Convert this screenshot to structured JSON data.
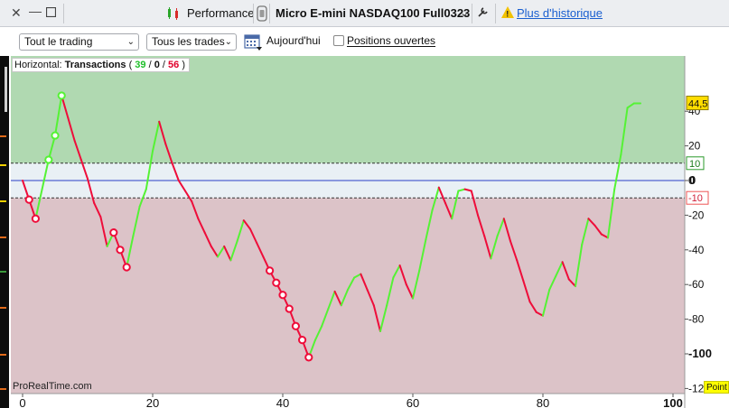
{
  "titlebar": {
    "title": "Performance",
    "instrument": "Micro E-mini NASDAQ100 Full0323",
    "history_link": "Plus d'historique"
  },
  "toolbar": {
    "trading_filter": "Tout le trading",
    "trades_filter": "Tous les trades",
    "today": "Aujourd'hui",
    "open_positions": "Positions ouvertes"
  },
  "chart": {
    "title_prefix": "Horizontal:",
    "title_main": "Transactions",
    "paren_open": "(",
    "wins": "39",
    "slash": "/",
    "neutral": "0",
    "losses": "56",
    "paren_close": ")",
    "watermark": "ProRealTime.com",
    "point_label": "Point",
    "colors": {
      "up": "#55f235",
      "down": "#ee0d3a",
      "profit_zone": "#b0d9b1",
      "loss_zone": "#dcc3c8",
      "neutral_band": "#e9f0f5",
      "zero_line": "#2b3fc7",
      "last_value_bg": "#ffdd00"
    }
  },
  "chart_data": {
    "type": "line",
    "xlim": [
      -2,
      100
    ],
    "ylim": [
      -120,
      50
    ],
    "x_ticks": [
      "0",
      "20",
      "40",
      "60",
      "80",
      "100"
    ],
    "y_ticks": [
      "40",
      "20",
      "0",
      "-20",
      "-40",
      "-60",
      "-80",
      "-100",
      "-12"
    ],
    "last_value": "44,5",
    "upper_level": "10",
    "lower_level": "-10",
    "upper_level_value": 10,
    "lower_level_value": -10,
    "zero_label": "0",
    "equity": [
      {
        "x": 0,
        "y": 0
      },
      {
        "x": 1,
        "y": -11
      },
      {
        "x": 2,
        "y": -22
      },
      {
        "x": 3,
        "y": -5
      },
      {
        "x": 4,
        "y": 12
      },
      {
        "x": 5,
        "y": 26
      },
      {
        "x": 6,
        "y": 49
      },
      {
        "x": 7,
        "y": 36
      },
      {
        "x": 8,
        "y": 23
      },
      {
        "x": 9,
        "y": 12
      },
      {
        "x": 10,
        "y": 1
      },
      {
        "x": 11,
        "y": -13
      },
      {
        "x": 12,
        "y": -21
      },
      {
        "x": 13,
        "y": -38
      },
      {
        "x": 14,
        "y": -30
      },
      {
        "x": 15,
        "y": -40
      },
      {
        "x": 16,
        "y": -50
      },
      {
        "x": 17,
        "y": -32
      },
      {
        "x": 18,
        "y": -15
      },
      {
        "x": 19,
        "y": -5
      },
      {
        "x": 20,
        "y": 17
      },
      {
        "x": 21,
        "y": 34
      },
      {
        "x": 22,
        "y": 21
      },
      {
        "x": 23,
        "y": 10
      },
      {
        "x": 24,
        "y": 0
      },
      {
        "x": 25,
        "y": -6
      },
      {
        "x": 26,
        "y": -12
      },
      {
        "x": 27,
        "y": -22
      },
      {
        "x": 28,
        "y": -30
      },
      {
        "x": 29,
        "y": -38
      },
      {
        "x": 30,
        "y": -44
      },
      {
        "x": 31,
        "y": -38
      },
      {
        "x": 32,
        "y": -46
      },
      {
        "x": 33,
        "y": -35
      },
      {
        "x": 34,
        "y": -23
      },
      {
        "x": 35,
        "y": -28
      },
      {
        "x": 36,
        "y": -36
      },
      {
        "x": 37,
        "y": -44
      },
      {
        "x": 38,
        "y": -52
      },
      {
        "x": 39,
        "y": -59
      },
      {
        "x": 40,
        "y": -66
      },
      {
        "x": 41,
        "y": -74
      },
      {
        "x": 42,
        "y": -84
      },
      {
        "x": 43,
        "y": -92
      },
      {
        "x": 44,
        "y": -102
      },
      {
        "x": 45,
        "y": -92
      },
      {
        "x": 46,
        "y": -84
      },
      {
        "x": 47,
        "y": -74
      },
      {
        "x": 48,
        "y": -64
      },
      {
        "x": 49,
        "y": -72
      },
      {
        "x": 50,
        "y": -63
      },
      {
        "x": 51,
        "y": -56
      },
      {
        "x": 52,
        "y": -54
      },
      {
        "x": 53,
        "y": -63
      },
      {
        "x": 54,
        "y": -72
      },
      {
        "x": 55,
        "y": -87
      },
      {
        "x": 56,
        "y": -72
      },
      {
        "x": 57,
        "y": -56
      },
      {
        "x": 58,
        "y": -49
      },
      {
        "x": 59,
        "y": -60
      },
      {
        "x": 60,
        "y": -68
      },
      {
        "x": 61,
        "y": -52
      },
      {
        "x": 62,
        "y": -34
      },
      {
        "x": 63,
        "y": -17
      },
      {
        "x": 64,
        "y": -4
      },
      {
        "x": 65,
        "y": -13
      },
      {
        "x": 66,
        "y": -22
      },
      {
        "x": 67,
        "y": -6
      },
      {
        "x": 68,
        "y": -5
      },
      {
        "x": 69,
        "y": -6
      },
      {
        "x": 70,
        "y": -20
      },
      {
        "x": 71,
        "y": -32
      },
      {
        "x": 72,
        "y": -45
      },
      {
        "x": 73,
        "y": -32
      },
      {
        "x": 74,
        "y": -22
      },
      {
        "x": 75,
        "y": -35
      },
      {
        "x": 76,
        "y": -46
      },
      {
        "x": 77,
        "y": -58
      },
      {
        "x": 78,
        "y": -70
      },
      {
        "x": 79,
        "y": -76
      },
      {
        "x": 80,
        "y": -78
      },
      {
        "x": 81,
        "y": -63
      },
      {
        "x": 82,
        "y": -55
      },
      {
        "x": 83,
        "y": -47
      },
      {
        "x": 84,
        "y": -57
      },
      {
        "x": 85,
        "y": -61
      },
      {
        "x": 86,
        "y": -37
      },
      {
        "x": 87,
        "y": -22
      },
      {
        "x": 88,
        "y": -26
      },
      {
        "x": 89,
        "y": -31
      },
      {
        "x": 90,
        "y": -33
      },
      {
        "x": 91,
        "y": -5
      },
      {
        "x": 92,
        "y": 15
      },
      {
        "x": 93,
        "y": 42
      },
      {
        "x": 94,
        "y": 44.5
      },
      {
        "x": 95,
        "y": 44.5
      }
    ],
    "markers": [
      {
        "x": 1,
        "y": -11,
        "color": "red"
      },
      {
        "x": 2,
        "y": -22,
        "color": "red"
      },
      {
        "x": 4,
        "y": 12,
        "color": "green"
      },
      {
        "x": 5,
        "y": 26,
        "color": "green"
      },
      {
        "x": 6,
        "y": 49,
        "color": "green"
      },
      {
        "x": 14,
        "y": -30,
        "color": "red"
      },
      {
        "x": 15,
        "y": -40,
        "color": "red"
      },
      {
        "x": 16,
        "y": -50,
        "color": "red"
      },
      {
        "x": 38,
        "y": -52,
        "color": "red"
      },
      {
        "x": 39,
        "y": -59,
        "color": "red"
      },
      {
        "x": 40,
        "y": -66,
        "color": "red"
      },
      {
        "x": 41,
        "y": -74,
        "color": "red"
      },
      {
        "x": 42,
        "y": -84,
        "color": "red"
      },
      {
        "x": 43,
        "y": -92,
        "color": "red"
      },
      {
        "x": 44,
        "y": -102,
        "color": "red"
      }
    ]
  }
}
